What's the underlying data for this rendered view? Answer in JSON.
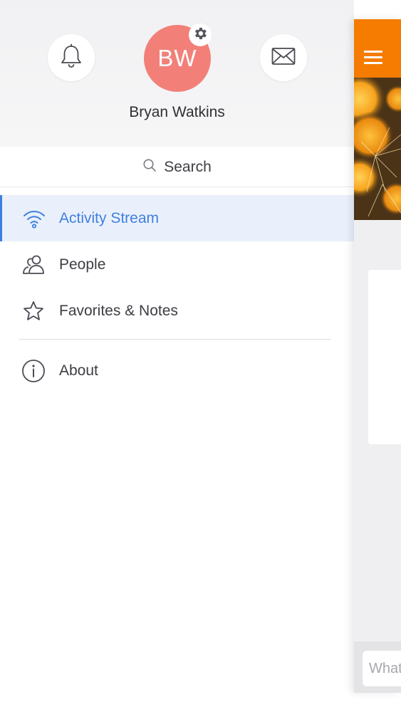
{
  "user": {
    "initials": "BW",
    "name": "Bryan Watkins",
    "avatar_color": "#f28079"
  },
  "header": {
    "notifications_icon": "bell-icon",
    "messages_icon": "envelope-icon",
    "settings_icon": "gear-icon"
  },
  "search": {
    "label": "Search",
    "icon": "search-icon"
  },
  "nav": {
    "items": [
      {
        "label": "Activity Stream",
        "icon": "wifi-icon",
        "active": true
      },
      {
        "label": "People",
        "icon": "people-icon",
        "active": false
      },
      {
        "label": "Favorites & Notes",
        "icon": "star-icon",
        "active": false
      },
      {
        "label": "About",
        "icon": "info-icon",
        "active": false
      }
    ]
  },
  "main": {
    "menu_icon": "hamburger-icon",
    "composer_placeholder": "What"
  },
  "colors": {
    "accent": "#3e80e0",
    "active_bg": "#eaf0fb",
    "topbar": "#f57c00",
    "text": "#3d3d44"
  }
}
